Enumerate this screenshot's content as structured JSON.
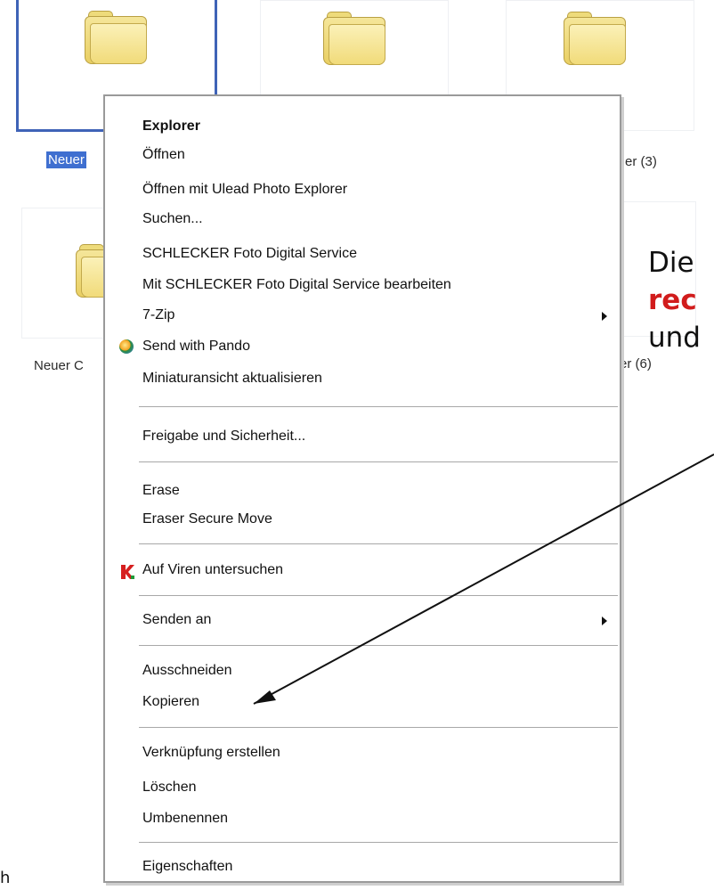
{
  "folders": {
    "top_left_label": "Neuer",
    "top_right_label": "er (3)",
    "middle_left_label": "Neuer C",
    "middle_right_label": "er (6)"
  },
  "context_menu": {
    "items": [
      {
        "label": "Explorer",
        "bold": true
      },
      {
        "label": "Öffnen"
      },
      {
        "label": "Öffnen mit Ulead Photo Explorer"
      },
      {
        "label": "Suchen..."
      },
      {
        "label": "SCHLECKER Foto Digital Service"
      },
      {
        "label": "Mit SCHLECKER Foto Digital Service bearbeiten"
      },
      {
        "label": "7-Zip",
        "has_submenu": true
      },
      {
        "label": "Send with Pando",
        "icon": "pando-icon"
      },
      {
        "label": "Miniaturansicht aktualisieren"
      },
      {
        "label": "Freigabe und Sicherheit..."
      },
      {
        "label": "Erase"
      },
      {
        "label": "Eraser Secure Move"
      },
      {
        "label": "Auf Viren untersuchen",
        "icon": "kaspersky-icon"
      },
      {
        "label": "Senden an",
        "has_submenu": true
      },
      {
        "label": "Ausschneiden"
      },
      {
        "label": "Kopieren"
      },
      {
        "label": "Verknüpfung erstellen"
      },
      {
        "label": "Löschen"
      },
      {
        "label": "Umbenennen"
      },
      {
        "label": "Eigenschaften"
      }
    ]
  },
  "annotation": {
    "line1": "Die",
    "line2": "rec",
    "line3": "und"
  },
  "bottom_fragment": "h",
  "colors": {
    "selection_blue": "#3f6fd0",
    "annotation_red": "#d11c1c",
    "menu_border": "#9a9a9a"
  }
}
